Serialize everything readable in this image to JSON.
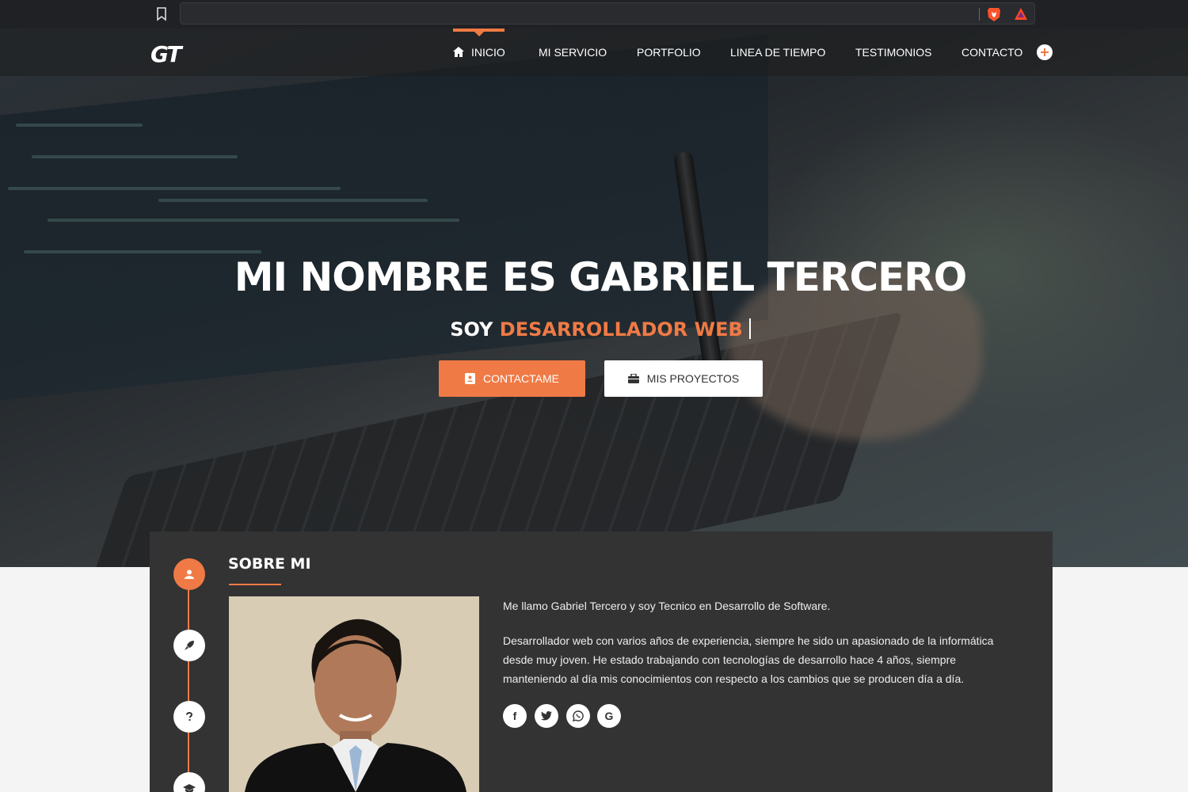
{
  "browser": {
    "icons": [
      "bookmark-icon",
      "brave-shield-icon",
      "bat-rewards-icon"
    ],
    "address": ""
  },
  "nav": {
    "logo": "GT",
    "items": [
      {
        "label": "INICIO",
        "active": true,
        "icon": "home-icon"
      },
      {
        "label": "MI SERVICIO"
      },
      {
        "label": "PORTFOLIO"
      },
      {
        "label": "LINEA DE TIEMPO"
      },
      {
        "label": "TESTIMONIOS"
      },
      {
        "label": "CONTACTO"
      }
    ],
    "extra_icon": "plus-circle-icon"
  },
  "hero": {
    "title": "MI NOMBRE ES GABRIEL TERCERO",
    "subtitle_prefix": "SOY",
    "subtitle_accent": "DESARROLLADOR WEB",
    "buttons": {
      "contact": {
        "label": "CONTACTAME",
        "icon": "contact-book-icon"
      },
      "projects": {
        "label": "MIS PROYECTOS",
        "icon": "briefcase-icon"
      }
    }
  },
  "about": {
    "title": "SOBRE MI",
    "intro": "Me llamo Gabriel Tercero y soy Tecnico en Desarrollo de Software.",
    "body_lines": [
      "Desarrollador web con varios años de experiencia, siempre he sido un apasionado de la informática",
      "desde muy joven. He estado trabajando con tecnologías de desarrollo hace 4 años, siempre",
      "manteniendo al día mis conocimientos con respecto a los cambios que se producen día a día."
    ],
    "timeline_icons": [
      "user-icon",
      "rocket-icon",
      "question-icon",
      "graduation-cap-icon"
    ],
    "social_icons": [
      "facebook-icon",
      "twitter-icon",
      "whatsapp-icon",
      "google-icon"
    ],
    "social_glyphs": [
      "f",
      "t",
      "w",
      "G"
    ]
  },
  "colors": {
    "accent": "#f07a45",
    "card": "#333333",
    "page_bg": "#f4f4f4"
  }
}
